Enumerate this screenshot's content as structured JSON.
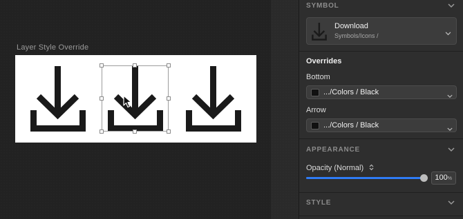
{
  "canvas": {
    "artboard_label": "Layer Style Override"
  },
  "inspector": {
    "symbol": {
      "header": "SYMBOL",
      "name": "Download",
      "path": "Symbols/Icons /",
      "icon": "download-icon"
    },
    "overrides": {
      "title": "Overrides",
      "bottom_label": "Bottom",
      "bottom_value": ".../Colors / Black",
      "arrow_label": "Arrow",
      "arrow_value": ".../Colors / Black"
    },
    "appearance": {
      "header": "APPEARANCE",
      "opacity_label": "Opacity (Normal)",
      "opacity_value": "100",
      "opacity_unit": "%",
      "opacity_fraction": 1.0
    },
    "style": {
      "header": "STYLE"
    }
  },
  "colors": {
    "accent": "#2f7cf6",
    "swatch": "#111111",
    "icon": "#1a1a1a"
  }
}
